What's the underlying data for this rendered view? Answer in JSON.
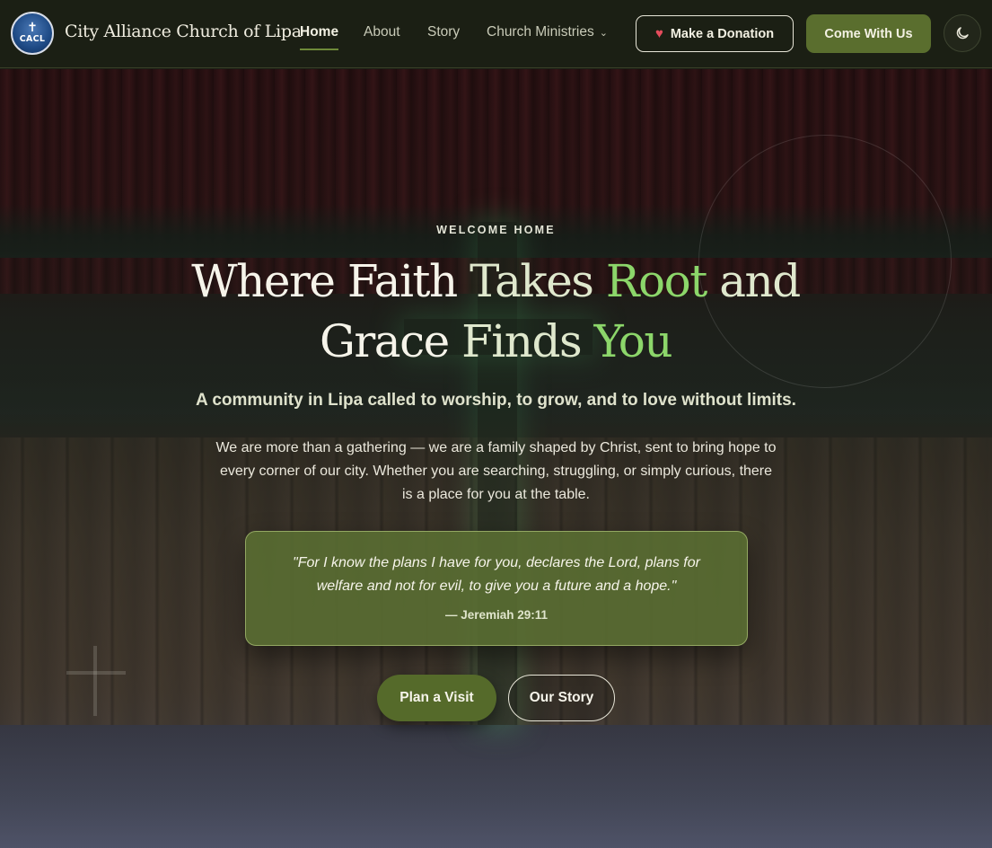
{
  "header": {
    "logo_abbr": "CACL",
    "brand_name": "City Alliance Church of Lipa",
    "nav": [
      {
        "label": "Home",
        "active": true
      },
      {
        "label": "About",
        "active": false
      },
      {
        "label": "Story",
        "active": false
      },
      {
        "label": "Church Ministries",
        "active": false,
        "has_dropdown": true
      }
    ],
    "donate_label": "Make a Donation",
    "donate_icon": "heart-icon",
    "cta_label": "Come With Us",
    "theme_toggle_icon": "moon-icon"
  },
  "hero": {
    "eyebrow": "WELCOME HOME",
    "headline": {
      "part1": "Where Faith ",
      "part2": "Takes ",
      "part3": "Root",
      "part4": " and",
      "part5": "Grace ",
      "part6": "Finds ",
      "part7": "You"
    },
    "subtitle": "A community in Lipa called to worship, to grow, and to love without limits.",
    "body": "We are more than a gathering — we are a family shaped by Christ, sent to bring hope to every corner of our city. Whether you are searching, struggling, or simply curious, there is a place for you at the table.",
    "verse": {
      "text": "\"For I know the plans I have for you, declares the Lord, plans for welfare and not for evil, to give you a future and a hope.\"",
      "reference": "— Jeremiah 29:11"
    },
    "primary_button": "Plan a Visit",
    "secondary_button": "Our Story"
  },
  "colors": {
    "header_bg": "#1b1f14",
    "accent_green": "#5a6e2e",
    "headline_accent": "#8cd66a",
    "verse_card_bg": "#5a6e32",
    "heart": "#e44c5c"
  }
}
